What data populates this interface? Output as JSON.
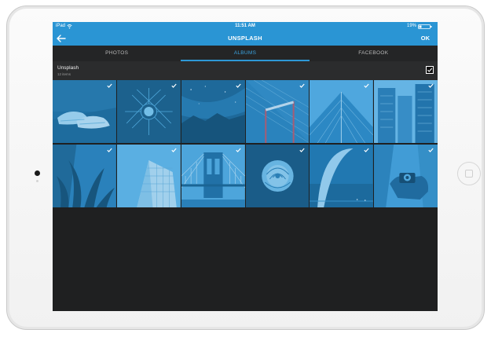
{
  "status_bar": {
    "carrier": "iPad",
    "time": "11:51 AM",
    "battery": "19%"
  },
  "nav": {
    "title": "UNSPLASH",
    "ok_label": "OK",
    "back_icon": "arrow-left-icon"
  },
  "tabs": [
    {
      "label": "PHOTOS",
      "active": false
    },
    {
      "label": "ALBUMS",
      "active": true
    },
    {
      "label": "FACEBOOK",
      "active": false
    }
  ],
  "album": {
    "name": "Unsplash",
    "count": "12 items",
    "selected": true
  },
  "photos": [
    {
      "subject": "sneakers",
      "selected": true
    },
    {
      "subject": "geometric-sculpture",
      "selected": true
    },
    {
      "subject": "night-sky",
      "selected": true
    },
    {
      "subject": "bridge-railing",
      "selected": true
    },
    {
      "subject": "glass-building",
      "selected": true
    },
    {
      "subject": "skyscrapers",
      "selected": true
    },
    {
      "subject": "plants",
      "selected": true
    },
    {
      "subject": "flatiron-building",
      "selected": true
    },
    {
      "subject": "brooklyn-bridge",
      "selected": true
    },
    {
      "subject": "rose",
      "selected": true
    },
    {
      "subject": "gateway-arch",
      "selected": true
    },
    {
      "subject": "photographer-camera",
      "selected": true
    }
  ],
  "colors": {
    "accent": "#2a95d4",
    "background": "#1f2021",
    "tile_overlay": "#2b8fcf"
  }
}
